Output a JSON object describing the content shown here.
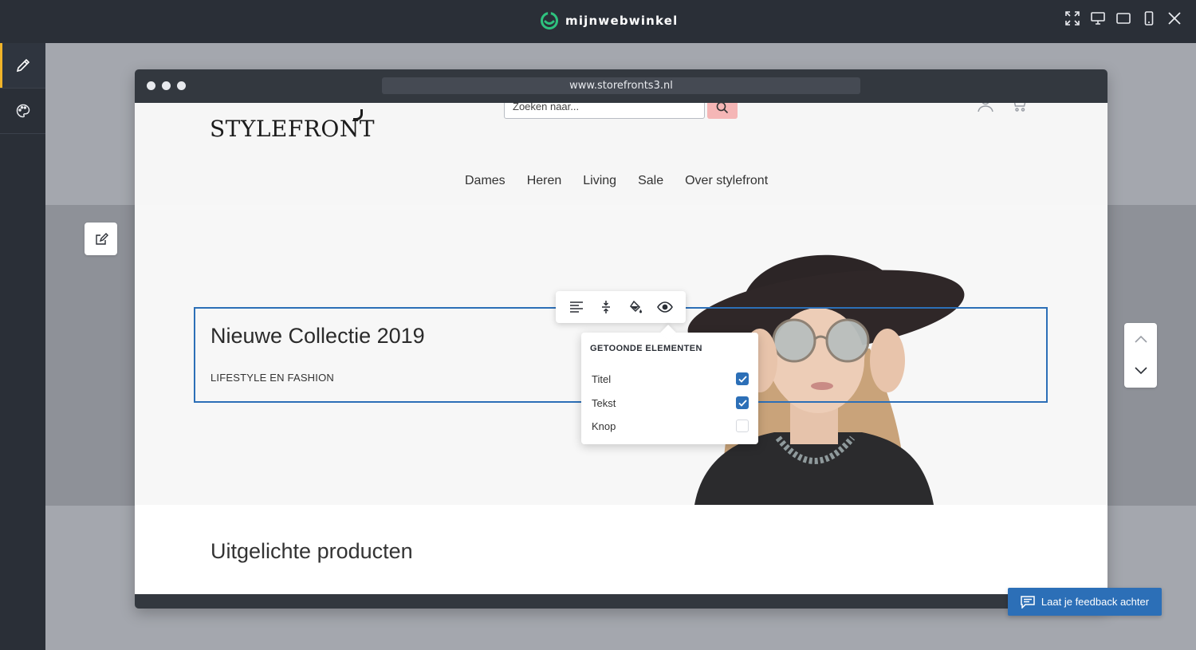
{
  "app": {
    "brand": "mijnwebwinkel",
    "top_icons": [
      "fullscreen-icon",
      "desktop-icon",
      "tablet-icon",
      "mobile-icon",
      "close-icon"
    ]
  },
  "sidebar": {
    "items": [
      {
        "name": "pencil-icon",
        "active": true
      },
      {
        "name": "palette-icon",
        "active": false
      }
    ]
  },
  "browser": {
    "url": "www.storefronts3.nl"
  },
  "store": {
    "logo": "STYLEFRONT",
    "search_placeholder": "Zoeken naar...",
    "nav": [
      "Dames",
      "Heren",
      "Living",
      "Sale",
      "Over stylefront"
    ]
  },
  "hero": {
    "title": "Nieuwe Collectie 2019",
    "subtitle": "LIFESTYLE EN FASHION"
  },
  "toolbar": {
    "tools": [
      "align-left-icon",
      "vertical-spacing-icon",
      "paint-bucket-icon",
      "eye-icon"
    ]
  },
  "dropdown": {
    "title": "GETOONDE ELEMENTEN",
    "items": [
      {
        "label": "Titel",
        "checked": true
      },
      {
        "label": "Tekst",
        "checked": true
      },
      {
        "label": "Knop",
        "checked": false
      }
    ]
  },
  "products": {
    "title": "Uitgelichte producten"
  },
  "feedback": {
    "label": "Laat je feedback achter"
  },
  "colors": {
    "accent": "#2c6fb7",
    "brand_green": "#2ec27e",
    "active_marker": "#f0b429",
    "chrome_dark": "#2a2f37"
  }
}
